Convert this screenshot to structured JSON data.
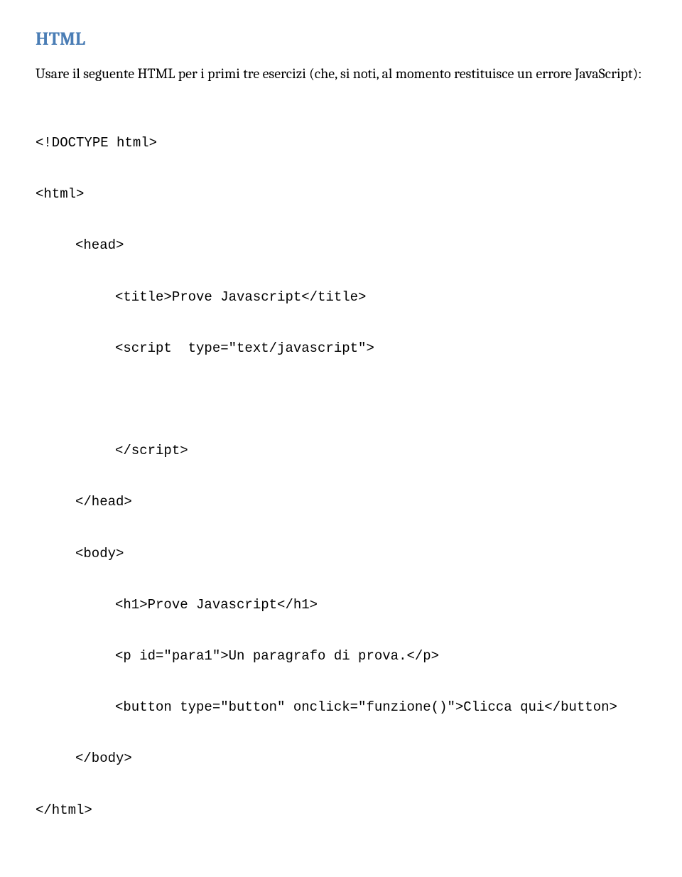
{
  "heading": "HTML",
  "intro": "Usare il seguente HTML per i primi tre esercizi (che, si noti, al momento restituisce un errore JavaScript):",
  "code": {
    "l1": "<!DOCTYPE html>",
    "l2": "<html>",
    "l3": "<head>",
    "l4": "<title>Prove Javascript</title>",
    "l5": "<script  type=\"text/javascript\">",
    "l6": "</script>",
    "l7": "</head>",
    "l8": "<body>",
    "l9": "<h1>Prove Javascript</h1>",
    "l10": "<p id=\"para1\">Un paragrafo di prova.</p>",
    "l11": "<button type=\"button\" onclick=\"funzione()\">Clicca qui</button>",
    "l12": "</body>",
    "l13": "</html>"
  }
}
